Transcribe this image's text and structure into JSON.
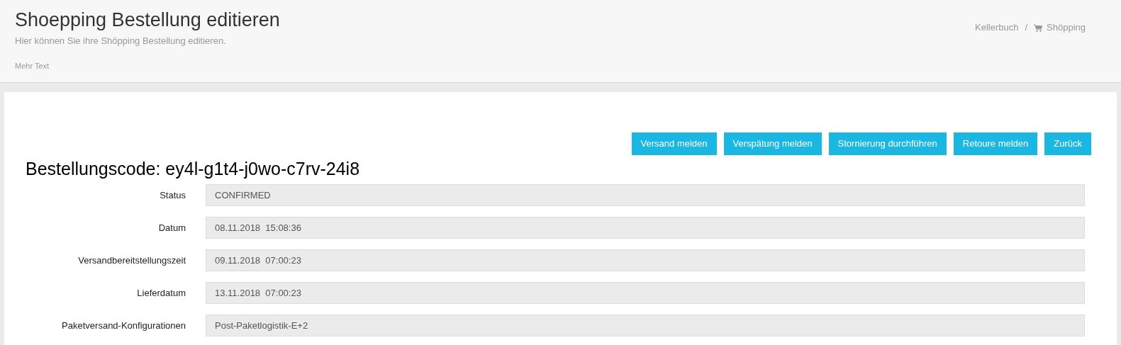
{
  "header": {
    "title": "Shoepping Bestellung editieren",
    "subtitle": "Hier können Sie ihre Shöpping Bestellung editieren.",
    "note": "Mehr Text"
  },
  "breadcrumb_separator": "/",
  "breadcrumb": [
    {
      "label": "Kellerbuch",
      "kind": "text"
    },
    {
      "label": "Shöpping",
      "kind": "cart"
    }
  ],
  "buttons": [
    "Versand melden",
    "Verspätung melden",
    "Stornierung durchführen",
    "Retoure melden",
    "Zurück"
  ],
  "order_title": "Bestellungscode: ey4l-g1t4-j0wo-c7rv-24i8",
  "fields": [
    {
      "label": "Status",
      "value": "CONFIRMED"
    },
    {
      "label": "Datum",
      "value": "08.11.2018  15:08:36"
    },
    {
      "label": "Versandbereitstellungszeit",
      "value": "09.11.2018  07:00:23"
    },
    {
      "label": "Lieferdatum",
      "value": "13.11.2018  07:00:23"
    },
    {
      "label": "Paketversand-Konfigurationen",
      "value": "Post-Paketlogistik-E+2"
    }
  ]
}
